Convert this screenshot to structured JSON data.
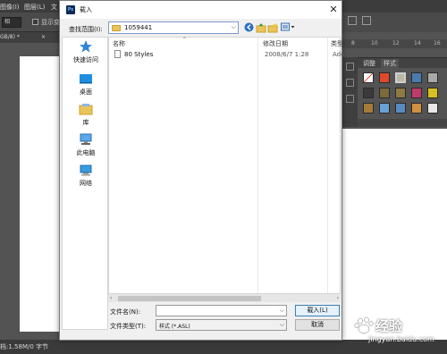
{
  "photoshop": {
    "menu": [
      "图像(I)",
      "图层(L)",
      "文"
    ],
    "options_label": "显示变",
    "options_box": "相",
    "doc_tab": "GB/8) *",
    "doc_tab_close": "×",
    "status": "档:1.58M/0 字节",
    "ruler_ticks": [
      "8",
      "10",
      "12",
      "14",
      "16"
    ],
    "panel_tabs": [
      "调整",
      "样式"
    ]
  },
  "dialog": {
    "title": "载入",
    "close": "✕",
    "look_in_label": "查找范围(I):",
    "look_in_value": "1059441",
    "columns": {
      "name": "名称",
      "date": "修改日期",
      "type": "类型"
    },
    "files": [
      {
        "name": "80 Styles",
        "date": "2008/6/7 1:28",
        "type": "Ado"
      }
    ],
    "places": [
      "快速访问",
      "桌面",
      "库",
      "此电脑",
      "网络"
    ],
    "file_name_label": "文件名(N):",
    "file_name_value": "",
    "file_type_label": "文件类型(T):",
    "file_type_value": "样式 (*.ASL)",
    "load_button": "载入(L)",
    "cancel_button": "取消"
  },
  "watermark": {
    "text": "经验",
    "url": "jingyan.baidu.com"
  },
  "colors": {
    "accent": "#0078d7",
    "ps_dark": "#535353",
    "folder": "#e9c45a"
  },
  "icons": [
    "back-icon",
    "up-folder-icon",
    "new-folder-icon",
    "view-menu-icon",
    "star-icon",
    "desktop-icon",
    "library-icon",
    "computer-icon",
    "network-icon"
  ]
}
